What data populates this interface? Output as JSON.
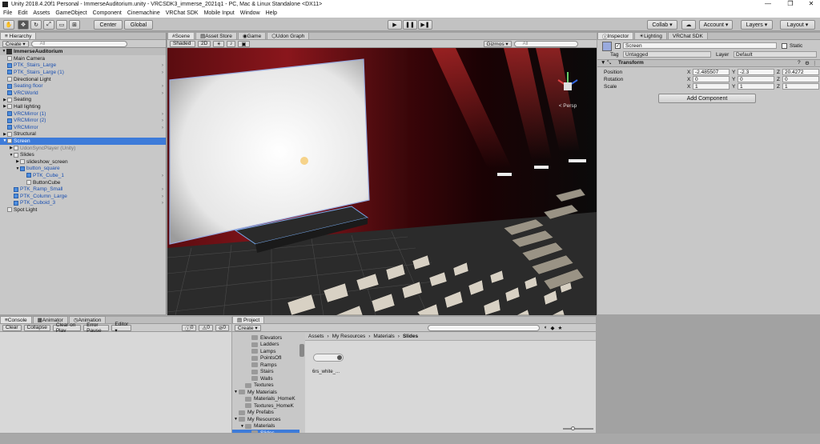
{
  "window": {
    "title": "Unity 2018.4.20f1 Personal - ImmerseAuditorium.unity - VRCSDK3_immerse_2021q1 - PC, Mac & Linux Standalone <DX11>",
    "controls": [
      "minimize-icon",
      "restore-icon",
      "close-icon"
    ]
  },
  "menu": [
    "File",
    "Edit",
    "Assets",
    "GameObject",
    "Component",
    "Cinemachine",
    "VRChat SDK",
    "Mobile Input",
    "Window",
    "Help"
  ],
  "toolbar": {
    "pivot_label": "Center",
    "space_label": "Global",
    "collab_label": "Collab ▾",
    "account_label": "Account",
    "layers_label": "Layers",
    "layout_label": "Layout"
  },
  "hierarchy": {
    "tab": "Hierarchy",
    "create_label": "Create ▾",
    "search_placeholder": "All",
    "scene_name": "ImmerseAuditorium",
    "items": [
      {
        "label": "Main Camera",
        "indent": 1,
        "style": "normal",
        "icon": "grey",
        "arrow": "",
        "chev": false
      },
      {
        "label": "PTK_Stairs_Large",
        "indent": 1,
        "style": "blue",
        "icon": "blue",
        "arrow": "",
        "chev": true
      },
      {
        "label": "PTK_Stairs_Large (1)",
        "indent": 1,
        "style": "blue",
        "icon": "blue",
        "arrow": "",
        "chev": true
      },
      {
        "label": "Directional Light",
        "indent": 1,
        "style": "normal",
        "icon": "grey",
        "arrow": "",
        "chev": false
      },
      {
        "label": "Seating floor",
        "indent": 1,
        "style": "blue",
        "icon": "blue",
        "arrow": "",
        "chev": true
      },
      {
        "label": "VRCWorld",
        "indent": 1,
        "style": "blue",
        "icon": "blue",
        "arrow": "",
        "chev": true
      },
      {
        "label": "Seating",
        "indent": 1,
        "style": "normal",
        "icon": "grey",
        "arrow": "▶",
        "chev": false
      },
      {
        "label": "Hall lighting",
        "indent": 1,
        "style": "normal",
        "icon": "grey",
        "arrow": "▶",
        "chev": false
      },
      {
        "label": "VRCMirror (1)",
        "indent": 1,
        "style": "blue",
        "icon": "blue",
        "arrow": "",
        "chev": true
      },
      {
        "label": "VRCMirror (2)",
        "indent": 1,
        "style": "blue",
        "icon": "blue",
        "arrow": "",
        "chev": true
      },
      {
        "label": "VRCMirror",
        "indent": 1,
        "style": "blue",
        "icon": "blue",
        "arrow": "",
        "chev": true
      },
      {
        "label": "Structural",
        "indent": 1,
        "style": "normal",
        "icon": "grey",
        "arrow": "▶",
        "chev": false
      },
      {
        "label": "Screen",
        "indent": 1,
        "style": "sel",
        "icon": "grey",
        "arrow": "▼",
        "chev": false
      },
      {
        "label": "UdonSyncPlayer (Unity)",
        "indent": 2,
        "style": "grey",
        "icon": "grey",
        "arrow": "▶",
        "chev": false
      },
      {
        "label": "Slides",
        "indent": 2,
        "style": "normal",
        "icon": "grey",
        "arrow": "▼",
        "chev": false
      },
      {
        "label": "slideshow_screen",
        "indent": 3,
        "style": "normal",
        "icon": "grey",
        "arrow": "▶",
        "chev": false
      },
      {
        "label": "button_square",
        "indent": 3,
        "style": "blue",
        "icon": "blue",
        "arrow": "▼",
        "chev": false
      },
      {
        "label": "PTK_Cube_1",
        "indent": 4,
        "style": "blue",
        "icon": "blue",
        "arrow": "",
        "chev": true
      },
      {
        "label": "ButtonCube",
        "indent": 4,
        "style": "normal",
        "icon": "grey",
        "arrow": "",
        "chev": false
      },
      {
        "label": "PTK_Ramp_Small",
        "indent": 2,
        "style": "blue",
        "icon": "blue",
        "arrow": "",
        "chev": true
      },
      {
        "label": "PTK_Column_Large",
        "indent": 2,
        "style": "blue",
        "icon": "blue",
        "arrow": "",
        "chev": true
      },
      {
        "label": "PTK_Cuboid_3",
        "indent": 2,
        "style": "blue",
        "icon": "blue",
        "arrow": "",
        "chev": true
      },
      {
        "label": "Spot Light",
        "indent": 1,
        "style": "normal",
        "icon": "grey",
        "arrow": "",
        "chev": false
      }
    ]
  },
  "scene": {
    "tabs": [
      "Scene",
      "Asset Store",
      "Game",
      "Udon Graph"
    ],
    "shading_label": "Shaded",
    "mode_2d_label": "2D",
    "gizmos_label": "Gizmos ▾",
    "search_placeholder": "All",
    "persp_label": "< Persp"
  },
  "inspector": {
    "tabs": [
      "Inspector",
      "Lighting",
      "VRChat SDK"
    ],
    "object_name": "Screen",
    "static_label": "Static",
    "tag_label": "Tag",
    "tag_value": "Untagged",
    "layer_label": "Layer",
    "layer_value": "Default",
    "component_title": "Transform",
    "rows": [
      {
        "label": "Position",
        "x": "-2.485507",
        "y": "-2.3",
        "z": "20.4272"
      },
      {
        "label": "Rotation",
        "x": "0",
        "y": "0",
        "z": "0"
      },
      {
        "label": "Scale",
        "x": "1",
        "y": "1",
        "z": "1"
      }
    ],
    "add_component_label": "Add Component"
  },
  "console": {
    "tabs": [
      "Console",
      "Animator",
      "Animation"
    ],
    "buttons": [
      "Clear",
      "Collapse",
      "Clear on Play",
      "Error Pause",
      "Editor ▾"
    ],
    "counts": [
      "0",
      "0",
      "0"
    ]
  },
  "project": {
    "tab": "Project",
    "create_label": "Create ▾",
    "tree": [
      {
        "label": "Elevators",
        "indent": 3
      },
      {
        "label": "Ladders",
        "indent": 3
      },
      {
        "label": "Lamps",
        "indent": 3
      },
      {
        "label": "PointsOfI",
        "indent": 3
      },
      {
        "label": "Ramps",
        "indent": 3
      },
      {
        "label": "Stairs",
        "indent": 3
      },
      {
        "label": "Walls",
        "indent": 3
      },
      {
        "label": "Textures",
        "indent": 2
      },
      {
        "label": "My Materials",
        "indent": 1,
        "arrow": "▼"
      },
      {
        "label": "Materials_HomeK",
        "indent": 2
      },
      {
        "label": "Textures_HomeK",
        "indent": 2
      },
      {
        "label": "My Prefabs",
        "indent": 1
      },
      {
        "label": "My Resources",
        "indent": 1,
        "arrow": "▼"
      },
      {
        "label": "Materials",
        "indent": 2,
        "arrow": "▼"
      },
      {
        "label": "Slides",
        "indent": 3,
        "selected": true
      }
    ],
    "breadcrumb": [
      "Assets",
      "My Resources",
      "Materials",
      "Slides"
    ],
    "asset_label": "6rs_white_..."
  },
  "colors": {
    "selection": "#3d7bd9",
    "prefab_text": "#1a4fb0",
    "editor_bg": "#c8c8c8"
  }
}
